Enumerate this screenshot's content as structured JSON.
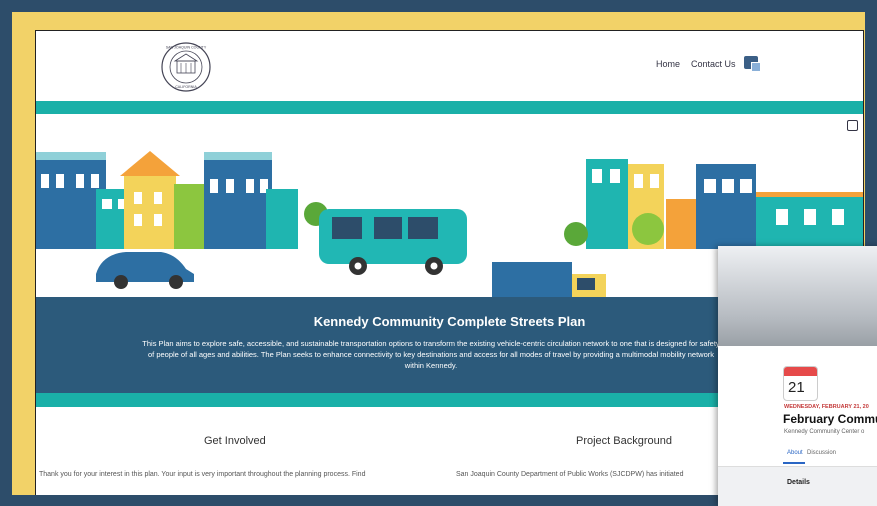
{
  "header": {
    "logo_text_top": "SAN JOAQUIN COUNTY",
    "logo_text_bottom": "CALIFORNIA",
    "nav": [
      {
        "label": "Home"
      },
      {
        "label": "Contact Us"
      }
    ]
  },
  "hero": {
    "title": "Kennedy Community Complete Streets Plan",
    "description": "This Plan aims to explore safe, accessible, and sustainable transportation options to transform the existing vehicle-centric circulation network to one that is designed for safety of people of all ages and abilities. The Plan seeks to enhance connectivity to key destinations and access for all modes of travel by providing a multimodal mobility network within Kennedy."
  },
  "sections": {
    "get_involved": {
      "title": "Get Involved",
      "text": "Thank you for your interest in this plan. Your input is very important throughout the planning process. Find"
    },
    "project_background": {
      "title": "Project Background",
      "text": "San Joaquin County Department of Public Works (SJCDPW) has initiated"
    }
  },
  "event_card": {
    "day": "21",
    "date_line": "WEDNESDAY, FEBRUARY 21, 20",
    "title": "February Commu",
    "subtitle": "Kennedy Community Center o",
    "tabs": [
      {
        "label": "About"
      },
      {
        "label": "Discussion"
      }
    ],
    "details_label": "Details"
  },
  "colors": {
    "teal": "#1ab0a8",
    "navy": "#2c5a7b",
    "frame_yellow": "#f2d268",
    "outer": "#2d4d6a"
  }
}
